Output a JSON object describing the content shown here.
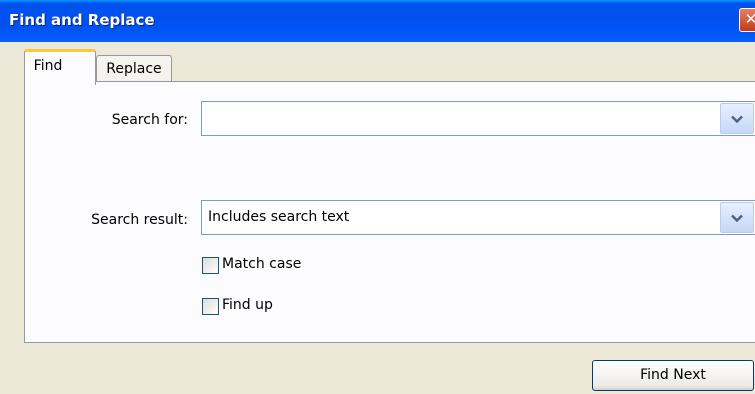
{
  "window": {
    "title": "Find and Replace",
    "close_glyph": "✕"
  },
  "tabs": [
    {
      "label": "Find",
      "selected": true
    },
    {
      "label": "Replace",
      "selected": false
    }
  ],
  "find": {
    "search_for_label": "Search for:",
    "search_for_value": "",
    "search_result_label": "Search result:",
    "search_result_value": "Includes search text",
    "match_case_label": "Match case",
    "match_case_checked": false,
    "find_up_label": "Find up",
    "find_up_checked": false
  },
  "buttons": {
    "find_next": "Find Next"
  },
  "colors": {
    "title_bar": "#0055ea",
    "active_tab_accent": "#ffc83c",
    "dialog_bg": "#ece9d8"
  },
  "icons": {
    "close": "close-icon",
    "dropdown": "chevron-down-icon"
  }
}
